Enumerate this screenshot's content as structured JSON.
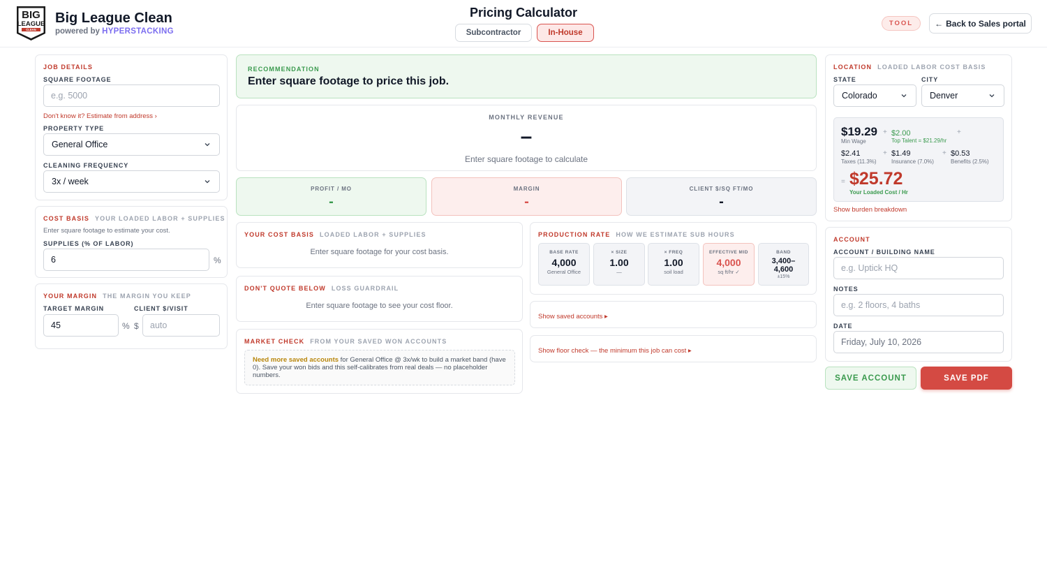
{
  "header": {
    "logo_text": [
      "BIG",
      "LEAGUE",
      "CLEAN"
    ],
    "brand_name": "Big League Clean",
    "powered_by": "powered by",
    "powered_brand": "HYPERSTACKING",
    "page_title": "Pricing Calculator",
    "modes": [
      "Subcontractor",
      "In-House"
    ],
    "active_mode": "In-House",
    "tool_badge": "TOOL",
    "back_label": "Back to Sales portal"
  },
  "job_details": {
    "title": "JOB DETAILS",
    "sqft_label": "SQUARE FOOTAGE",
    "sqft_placeholder": "e.g. 5000",
    "sqft_value": "",
    "estimate_link": "Don't know it? Estimate from address ›",
    "property_type_label": "PROPERTY TYPE",
    "property_type": "General Office",
    "frequency_label": "CLEANING FREQUENCY",
    "frequency": "3x / week"
  },
  "cost_basis": {
    "title": "COST BASIS",
    "subtitle": "YOUR LOADED LABOR + SUPPLIES",
    "hint": "Enter square footage to estimate your cost.",
    "supplies_label": "SUPPLIES (% OF LABOR)",
    "supplies_value": "6",
    "unit": "%"
  },
  "your_margin": {
    "title": "YOUR MARGIN",
    "subtitle": "THE MARGIN YOU KEEP",
    "target_label": "TARGET MARGIN",
    "target_value": "45",
    "percent_unit": "%",
    "client_label": "CLIENT $/VISIT",
    "dollar_unit": "$",
    "client_placeholder": "auto"
  },
  "recommendation": {
    "label": "RECOMMENDATION",
    "text": "Enter square footage to price this job."
  },
  "revenue": {
    "label": "MONTHLY REVENUE",
    "value": "–",
    "hint": "Enter square footage to calculate"
  },
  "metrics": [
    {
      "label": "PROFIT / MO",
      "value": "-"
    },
    {
      "label": "MARGIN",
      "value": "-"
    },
    {
      "label": "CLIENT $/SQ FT/MO",
      "value": "-"
    }
  ],
  "your_cost_basis": {
    "title": "YOUR COST BASIS",
    "subtitle": "LOADED LABOR + SUPPLIES",
    "message": "Enter square footage for your cost basis."
  },
  "dont_quote": {
    "title": "DON'T QUOTE BELOW",
    "subtitle": "LOSS GUARDRAIL",
    "message": "Enter square footage to see your cost floor."
  },
  "market_check": {
    "title": "MARKET CHECK",
    "subtitle": "FROM YOUR SAVED WON ACCOUNTS",
    "notice_bold": "Need more saved accounts",
    "notice_text": " for General Office @ 3x/wk to build a market band (have 0). Save your won bids and this self-calibrates from real deals — no placeholder numbers."
  },
  "production_rate": {
    "title": "PRODUCTION RATE",
    "subtitle": "HOW WE ESTIMATE SUB HOURS",
    "tiles": [
      {
        "label": "BASE RATE",
        "value": "4,000",
        "sub": "General Office"
      },
      {
        "label": "× SIZE",
        "value": "1.00",
        "sub": "—"
      },
      {
        "label": "× FREQ",
        "value": "1.00",
        "sub": "soil load"
      },
      {
        "label": "EFFECTIVE MID",
        "value": "4,000",
        "sub": "sq ft/hr ✓"
      },
      {
        "label": "BAND",
        "value_line1": "3,400–",
        "value_line2": "4,600",
        "sub": "±15%"
      }
    ]
  },
  "show_saved": "Show saved accounts ▸",
  "show_floor": "Show floor check — the minimum this job can cost ▸",
  "location": {
    "title": "LOCATION",
    "subtitle": "LOADED LABOR COST BASIS",
    "state_label": "STATE",
    "state": "Colorado",
    "city_label": "CITY",
    "city": "Denver",
    "labor": {
      "min_wage": "$19.29",
      "min_wage_label": "Min Wage",
      "top_talent": "$2.00",
      "top_talent_label": "Top Talent = $21.29/hr",
      "taxes": "$2.41",
      "taxes_label": "Taxes (11.3%)",
      "insurance": "$1.49",
      "insurance_label": "Insurance (7.0%)",
      "benefits": "$0.53",
      "benefits_label": "Benefits (2.5%)",
      "plus": "+",
      "equals": "=",
      "loaded_cost": "$25.72",
      "loaded_cost_label": "Your Loaded Cost / Hr"
    },
    "burden_link": "Show burden breakdown"
  },
  "account": {
    "title": "ACCOUNT",
    "name_label": "ACCOUNT / BUILDING NAME",
    "name_placeholder": "e.g. Uptick HQ",
    "notes_label": "NOTES",
    "notes_placeholder": "e.g. 2 floors, 4 baths",
    "date_label": "DATE",
    "date_value": "Friday, July 10, 2026"
  },
  "buttons": {
    "save_account": "SAVE ACCOUNT",
    "save_pdf": "SAVE PDF"
  },
  "colors": {
    "accent_red": "#c0392b",
    "accent_green": "#3a9a4e",
    "brand_purple": "#7c6ef0"
  }
}
